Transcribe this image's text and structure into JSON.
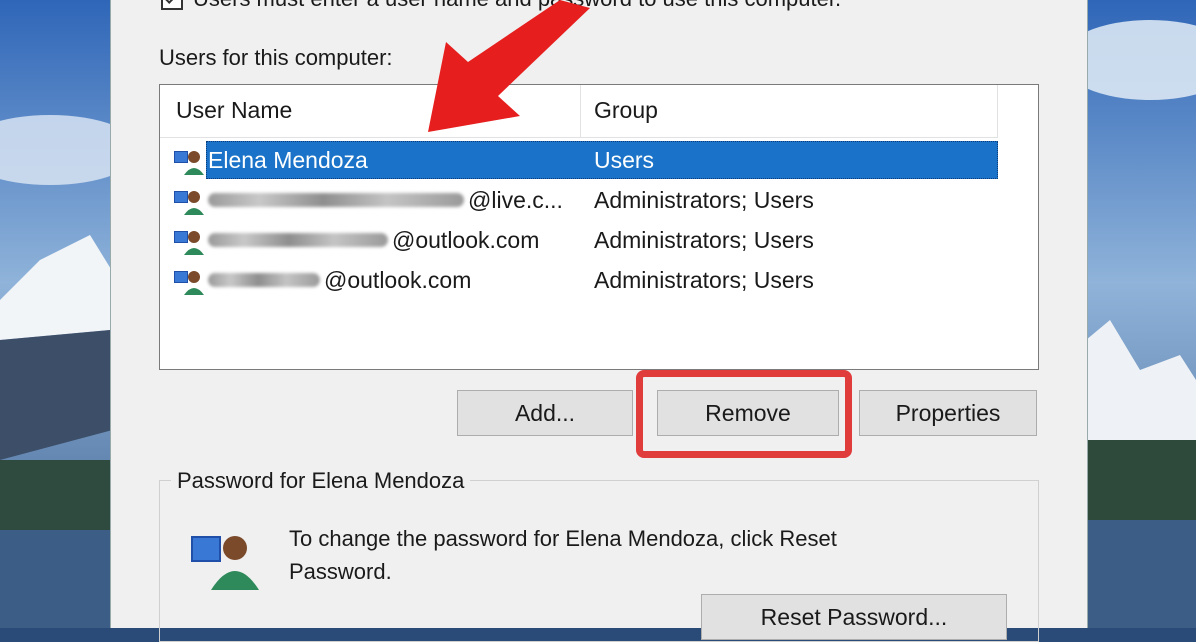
{
  "dialog": {
    "top_checkbox_label": "Users must enter a user name and password to use this computer.",
    "users_label": "Users for this computer:",
    "columns": {
      "user_name": "User Name",
      "group": "Group"
    },
    "users": [
      {
        "name": "Elena Mendoza",
        "group": "Users",
        "selected": true
      },
      {
        "name_suffix": "@live.c...",
        "group": "Administrators; Users",
        "selected": false
      },
      {
        "name_suffix": "@outlook.com",
        "group": "Administrators; Users",
        "selected": false
      },
      {
        "name_suffix": "@outlook.com",
        "group": "Administrators; Users",
        "selected": false
      }
    ],
    "buttons": {
      "add": "Add...",
      "remove": "Remove",
      "properties": "Properties",
      "reset_password": "Reset Password..."
    },
    "password_group_title": "Password for Elena Mendoza",
    "password_text": "To change the password for Elena Mendoza, click Reset Password."
  },
  "colors": {
    "selection": "#1a73c8",
    "annotation_red": "#e03c3c",
    "dialog_bg": "#f0f0f0"
  },
  "icons": [
    "user-icon",
    "user-password-icon",
    "annotation-arrow-icon"
  ]
}
